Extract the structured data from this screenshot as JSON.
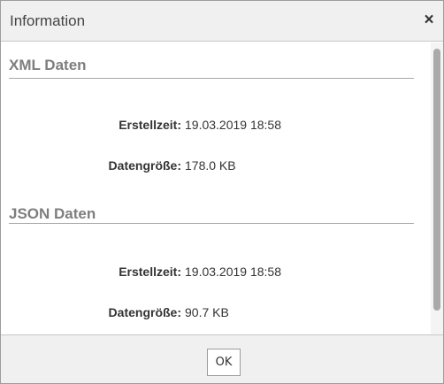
{
  "dialog": {
    "title": "Information",
    "close_glyph": "×",
    "ok_label": "OK"
  },
  "sections": [
    {
      "title": "XML Daten",
      "created_label": "Erstellzeit:",
      "created_value": "19.03.2019 18:58",
      "size_label": "Datengröße:",
      "size_value": "178.0 KB"
    },
    {
      "title": "JSON Daten",
      "created_label": "Erstellzeit:",
      "created_value": "19.03.2019 18:58",
      "size_label": "Datengröße:",
      "size_value": "90.7 KB"
    }
  ]
}
